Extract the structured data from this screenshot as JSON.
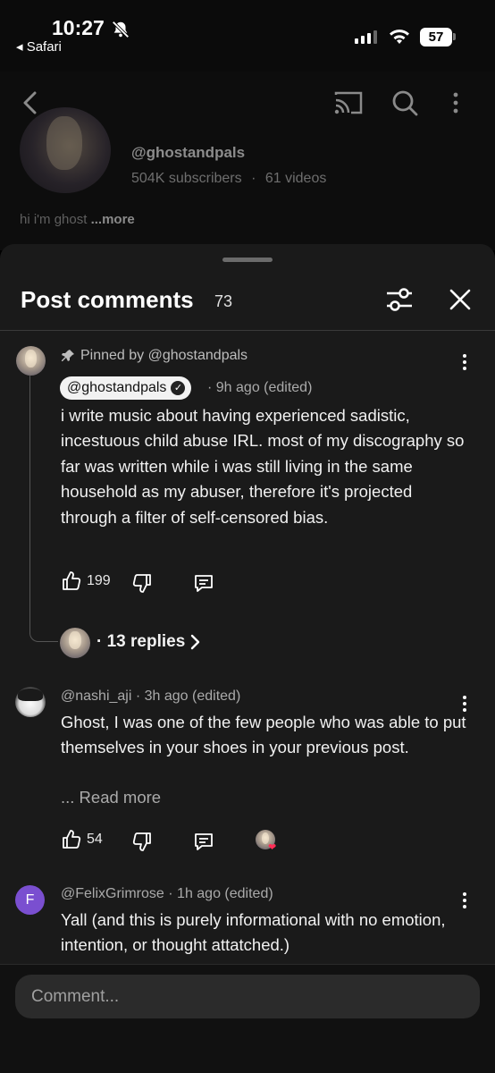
{
  "status_bar": {
    "time": "10:27",
    "back_app": "◂ Safari",
    "battery": "57"
  },
  "channel": {
    "handle": "@ghostandpals",
    "subscribers": "504K subscribers",
    "separator": "·",
    "videos": "61 videos",
    "bio": "hi i'm ghost",
    "bio_more": "...more"
  },
  "sheet": {
    "title": "Post comments",
    "count": "73"
  },
  "comments": [
    {
      "pinned_label": "Pinned by @ghostandpals",
      "author": "@ghostandpals",
      "time": "· 9h ago (edited)",
      "text": "i write music about having experienced sadistic, incestuous child abuse IRL. most of my discography so far was written while i was still living in the same household as my abuser, therefore it's projected through a filter of self-censored bias.",
      "likes": "199",
      "replies": "· 13 replies"
    },
    {
      "author": "@nashi_aji",
      "time": "· 3h ago (edited)",
      "text": "Ghost, I was one of the few people who was able to put themselves in your shoes in your previous post.",
      "read_more": "... Read more",
      "likes": "54"
    },
    {
      "avatar_letter": "F",
      "author": "@FelixGrimrose",
      "time": "· 1h ago (edited)",
      "text": "Yall (and this is purely informational with no emotion, intention, or thought attatched.)"
    }
  ],
  "input": {
    "placeholder": "Comment..."
  },
  "colors": {
    "sheet_bg": "#1a1a1a",
    "heart": "#ff2d55",
    "avatar_f": "#7a4fd0"
  },
  "icons": [
    "bell-off-icon",
    "signal-icon",
    "wifi-icon",
    "back-arrow-icon",
    "cast-icon",
    "search-icon",
    "more-vert-icon",
    "filter-icon",
    "close-icon",
    "pin-icon",
    "verified-icon",
    "thumb-up-icon",
    "thumb-down-icon",
    "reply-icon",
    "chevron-right-icon",
    "heart-icon"
  ]
}
